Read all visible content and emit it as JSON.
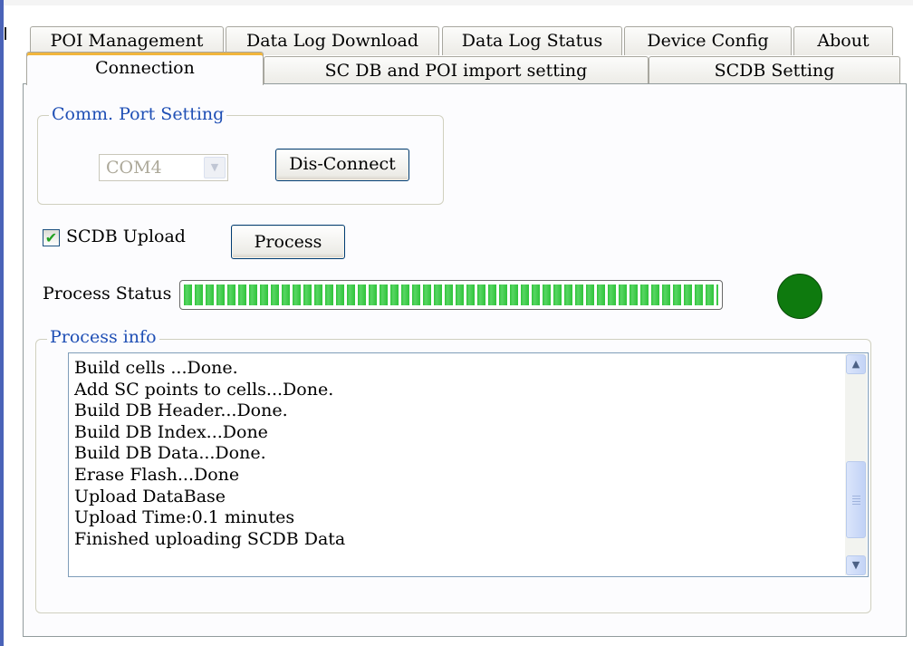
{
  "tabs_back": [
    "POI Management",
    "Data Log Download",
    "Data Log Status",
    "Device Config",
    "About"
  ],
  "tabs_front": [
    "Connection",
    "SC DB and POI import setting",
    "SCDB  Setting"
  ],
  "active_tab": "Connection",
  "comm_port": {
    "legend": "Comm. Port Setting",
    "port_value": "COM4",
    "disconnect_label": "Dis-Connect"
  },
  "scdb_upload": {
    "label": "SCDB Upload",
    "checked": true
  },
  "process_button_label": "Process",
  "process_status": {
    "label": "Process Status",
    "progress_percent": 100,
    "indicator_color": "#0e7a0e"
  },
  "process_info": {
    "legend": "Process info",
    "lines": [
      "Build cells ...Done.",
      "Add SC points to cells...Done.",
      "Build DB Header...Done.",
      "Build DB Index...Done",
      "Build DB Data...Done.",
      "Erase Flash...Done",
      "Upload DataBase",
      "Upload Time:0.1 minutes",
      "Finished uploading SCDB Data"
    ]
  },
  "icons": {
    "dropdown": "chevron-down-icon",
    "check": "check-icon",
    "scroll_up": "chevron-up-icon",
    "scroll_down": "chevron-down-icon"
  }
}
